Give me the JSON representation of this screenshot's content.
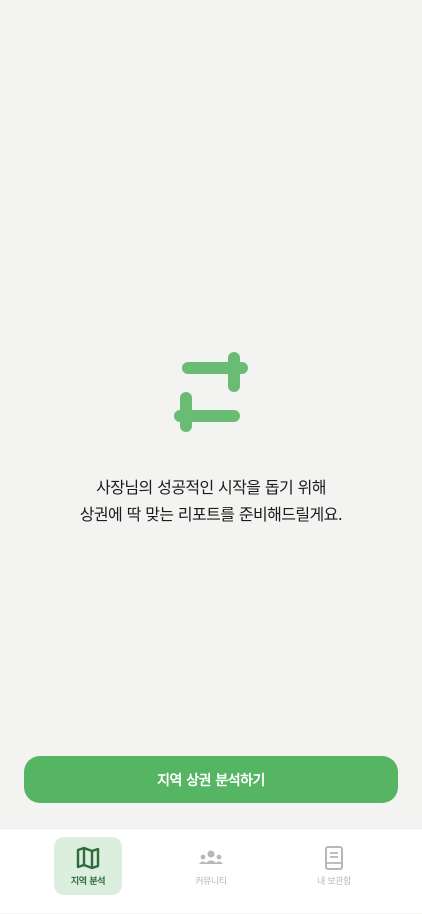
{
  "colors": {
    "background": "#f3f3f2",
    "accent": "#55b563",
    "logo": "#6abc74",
    "active_tab_bg": "#dcefdf",
    "active_tab_text": "#2f6b3c",
    "inactive_tab": "#b7b7b7"
  },
  "logo": {
    "icon": "app-logo-icon"
  },
  "message": {
    "line1": "사장님의 성공적인 시작을 돕기 위해",
    "line2": "상권에 딱 맞는 리포트를 준비해드릴게요."
  },
  "cta": {
    "label": "지역 상권 분석하기"
  },
  "tabbar": {
    "tabs": [
      {
        "label": "지역 분석",
        "icon": "map-icon",
        "active": true
      },
      {
        "label": "커뮤니티",
        "icon": "community-icon",
        "active": false
      },
      {
        "label": "내 보관함",
        "icon": "archive-icon",
        "active": false
      }
    ]
  }
}
